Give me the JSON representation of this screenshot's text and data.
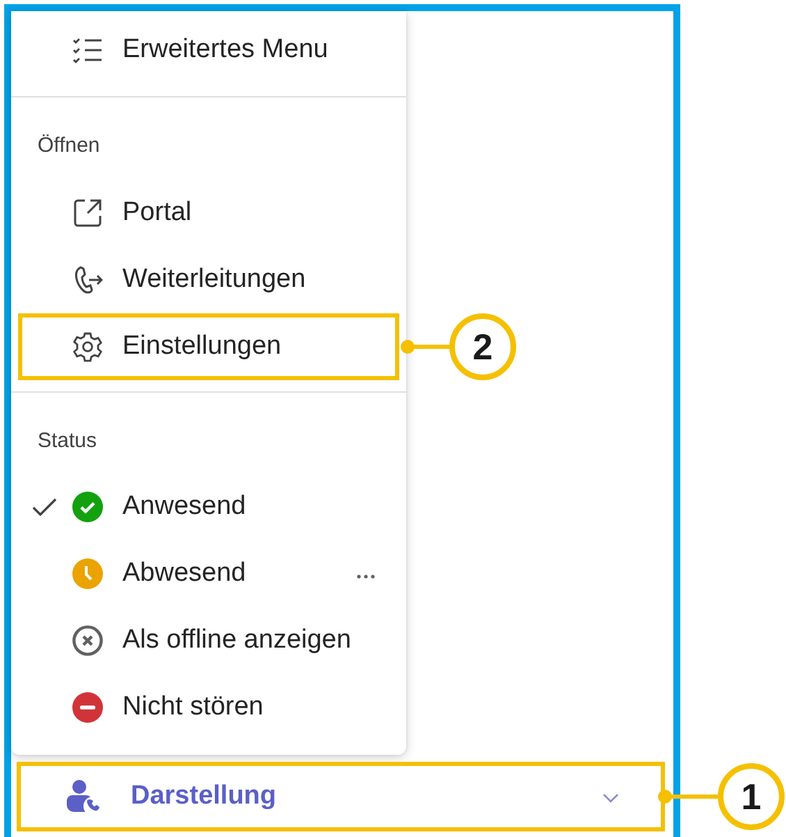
{
  "menu": {
    "header": {
      "label": "Erweitertes Menu"
    },
    "sections": [
      {
        "title": "Öffnen",
        "items": [
          {
            "kind": "portal",
            "label": "Portal",
            "highlighted": false
          },
          {
            "kind": "forward",
            "label": "Weiterleitungen",
            "highlighted": false
          },
          {
            "kind": "settings",
            "label": "Einstellungen",
            "highlighted": true,
            "callout": "2"
          }
        ]
      },
      {
        "title": "Status",
        "items": [
          {
            "kind": "available",
            "label": "Anwesend",
            "checked": true,
            "more": false,
            "color": "#13a10e"
          },
          {
            "kind": "away",
            "label": "Abwesend",
            "checked": false,
            "more": true,
            "color": "#eaa300"
          },
          {
            "kind": "offline",
            "label": "Als offline anzeigen",
            "checked": false,
            "more": false,
            "color": "#616161"
          },
          {
            "kind": "busy",
            "label": "Nicht stören",
            "checked": false,
            "more": false,
            "color": "#d13438"
          }
        ]
      }
    ]
  },
  "bottom_bar": {
    "label": "Darstellung",
    "highlighted": true,
    "callout": "1"
  }
}
